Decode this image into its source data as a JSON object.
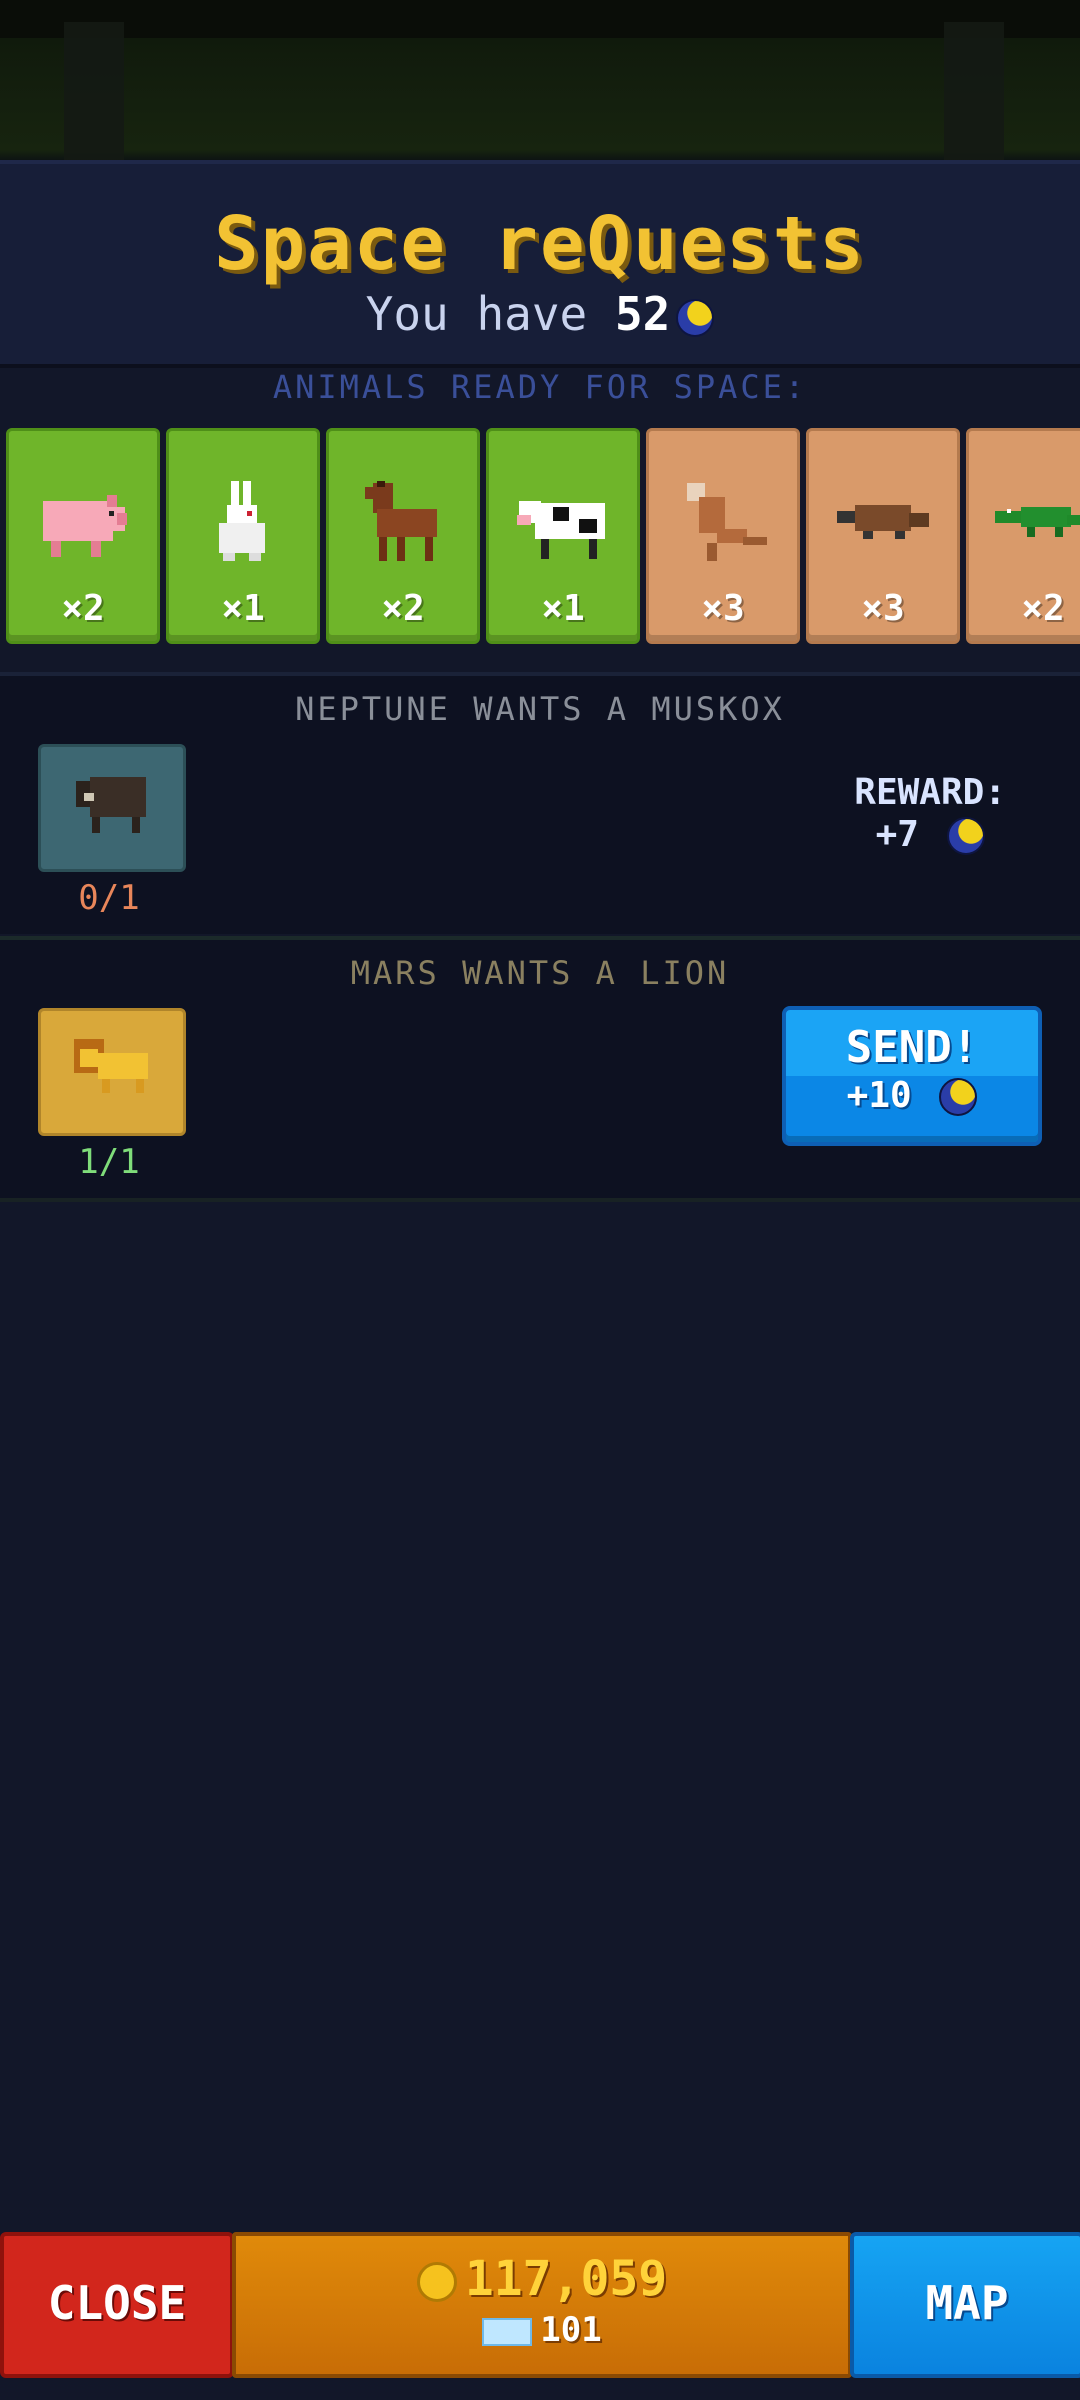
{
  "header": {
    "title": "Space reQuests",
    "have_prefix": "You have",
    "have_amount": "52"
  },
  "ready_label": "ANIMALS READY FOR SPACE:",
  "animals": [
    {
      "name": "pig",
      "count": "×2",
      "bg": "green"
    },
    {
      "name": "rabbit",
      "count": "×1",
      "bg": "green"
    },
    {
      "name": "horse",
      "count": "×2",
      "bg": "green"
    },
    {
      "name": "cow",
      "count": "×1",
      "bg": "green"
    },
    {
      "name": "kangaroo",
      "count": "×3",
      "bg": "sand"
    },
    {
      "name": "platypus",
      "count": "×3",
      "bg": "sand"
    },
    {
      "name": "crocodile",
      "count": "×2",
      "bg": "sand"
    }
  ],
  "quests": [
    {
      "title": "NEPTUNE WANTS A MUSKOX",
      "progress": "0/1",
      "reward_label": "REWARD:",
      "reward_value": "+7"
    },
    {
      "title": "MARS WANTS A LION",
      "progress": "1/1",
      "send_label": "SEND!",
      "send_value": "+10"
    }
  ],
  "bottom": {
    "close_label": "CLOSE",
    "coins": "117,059",
    "gems": "101",
    "map_label": "MAP"
  },
  "colors": {
    "title": "#f2c233",
    "send": "#1ba4f5",
    "close": "#d2261c",
    "center": "#e08a0a",
    "progress_incomplete": "#e8865a",
    "progress_complete": "#7fdc7a"
  }
}
